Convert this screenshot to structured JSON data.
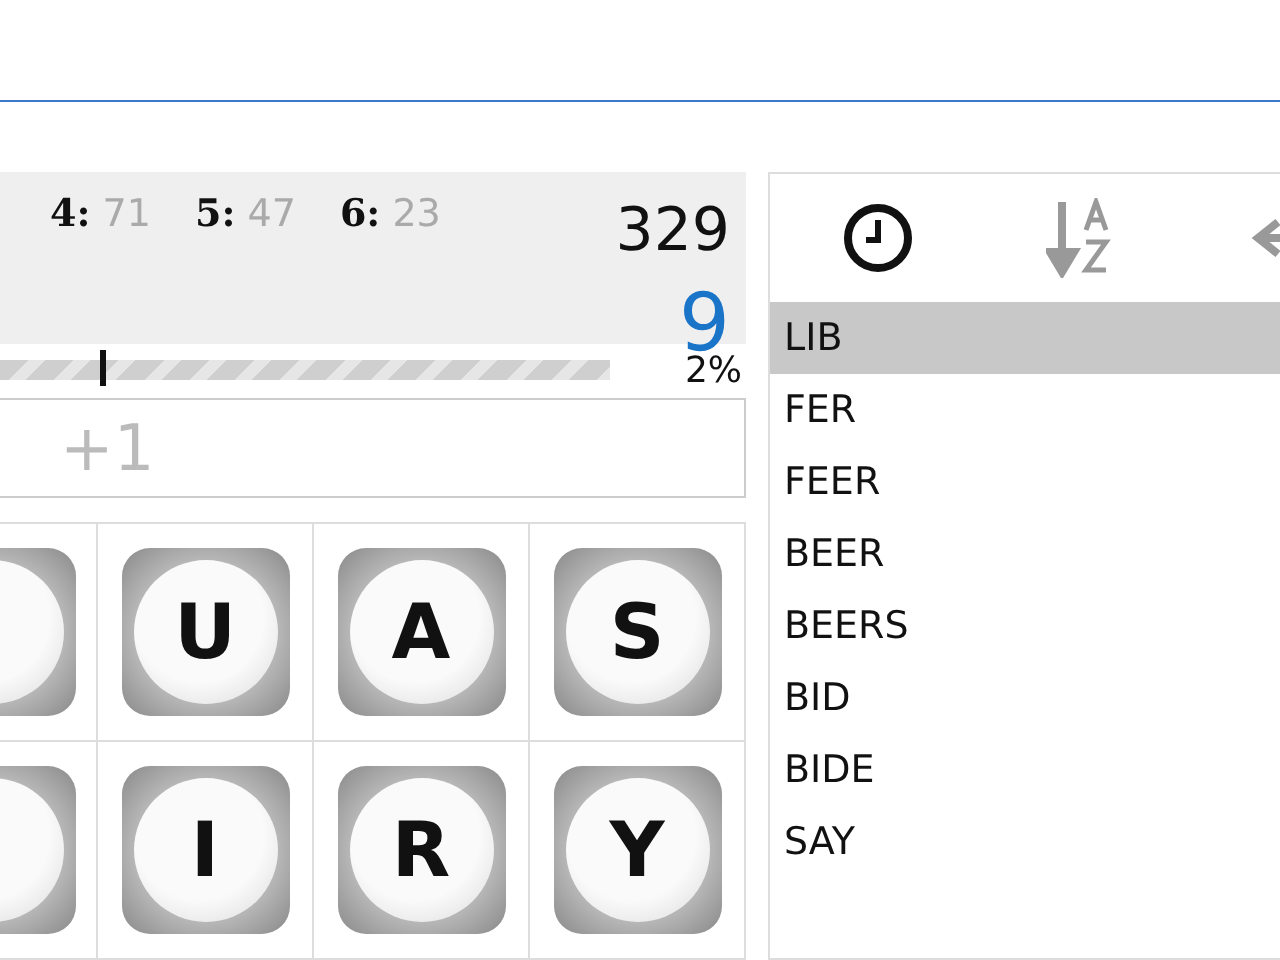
{
  "stats": [
    {
      "label": "4:",
      "value": "71"
    },
    {
      "label": "5:",
      "value": "47"
    },
    {
      "label": "6:",
      "value": "23"
    }
  ],
  "score": "329",
  "found": "9",
  "progress": {
    "reading": "2%"
  },
  "entry": {
    "value": "+1"
  },
  "board": [
    [
      {
        "kind": "partial"
      },
      {
        "kind": "die",
        "letter": "U"
      },
      {
        "kind": "die",
        "letter": "A"
      },
      {
        "kind": "die",
        "letter": "S"
      }
    ],
    [
      {
        "kind": "partial"
      },
      {
        "kind": "die",
        "letter": "I"
      },
      {
        "kind": "die",
        "letter": "R"
      },
      {
        "kind": "die",
        "letter": "Y"
      }
    ]
  ],
  "toolbar": [
    {
      "kind": "clock",
      "selected": true
    },
    {
      "kind": "sort",
      "selected": false
    },
    {
      "kind": "back",
      "selected": false
    }
  ],
  "words": [
    {
      "text": "LIB",
      "selected": true
    },
    {
      "text": "FER",
      "selected": false
    },
    {
      "text": "FEER",
      "selected": false
    },
    {
      "text": "BEER",
      "selected": false
    },
    {
      "text": "BEERS",
      "selected": false
    },
    {
      "text": "BID",
      "selected": false
    },
    {
      "text": "BIDE",
      "selected": false
    },
    {
      "text": "SAY",
      "selected": false
    }
  ]
}
